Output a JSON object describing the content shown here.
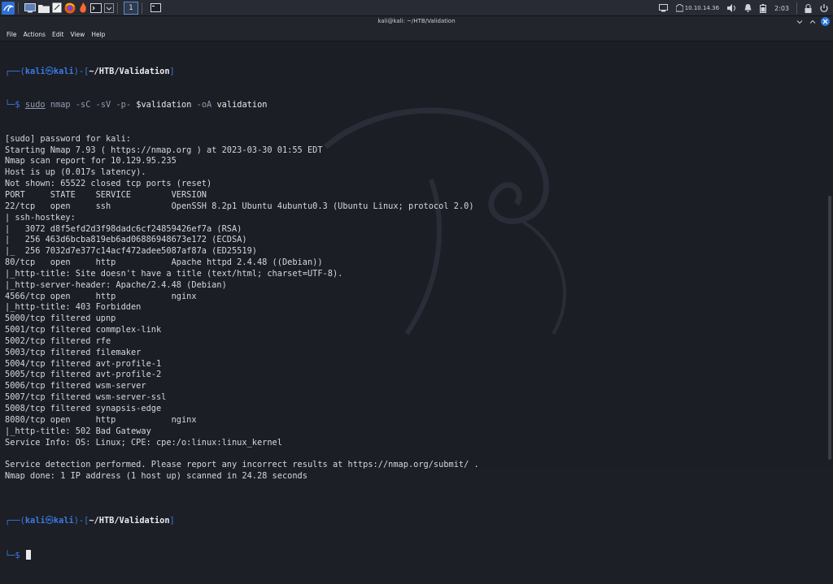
{
  "panel": {
    "workspace": "1",
    "ip": "10.10.14.36",
    "time": "2:03"
  },
  "window": {
    "title": "kali@kali: ~/HTB/Validation"
  },
  "menu": {
    "file": "File",
    "actions": "Actions",
    "edit": "Edit",
    "view": "View",
    "help": "Help"
  },
  "prompt1": {
    "corner": "┌──(",
    "user": "kali",
    "at": "㉿",
    "host": "kali",
    "mid": ")-[",
    "path": "~/HTB/Validation",
    "end": "]",
    "arrow": "└─$ ",
    "sudo": "sudo",
    "cmd": "nmap",
    "args": "-sC -sV -p-",
    "var": "$validation",
    "oa": "-oA",
    "out": "validation"
  },
  "output": [
    "[sudo] password for kali:",
    "Starting Nmap 7.93 ( https://nmap.org ) at 2023-03-30 01:55 EDT",
    "Nmap scan report for 10.129.95.235",
    "Host is up (0.017s latency).",
    "Not shown: 65522 closed tcp ports (reset)",
    "PORT     STATE    SERVICE        VERSION",
    "22/tcp   open     ssh            OpenSSH 8.2p1 Ubuntu 4ubuntu0.3 (Ubuntu Linux; protocol 2.0)",
    "| ssh-hostkey:",
    "|   3072 d8f5efd2d3f98dadc6cf24859426ef7a (RSA)",
    "|   256 463d6bcba819eb6ad06886948673e172 (ECDSA)",
    "|_  256 7032d7e377c14acf472adee5087af87a (ED25519)",
    "80/tcp   open     http           Apache httpd 2.4.48 ((Debian))",
    "|_http-title: Site doesn't have a title (text/html; charset=UTF-8).",
    "|_http-server-header: Apache/2.4.48 (Debian)",
    "4566/tcp open     http           nginx",
    "|_http-title: 403 Forbidden",
    "5000/tcp filtered upnp",
    "5001/tcp filtered commplex-link",
    "5002/tcp filtered rfe",
    "5003/tcp filtered filemaker",
    "5004/tcp filtered avt-profile-1",
    "5005/tcp filtered avt-profile-2",
    "5006/tcp filtered wsm-server",
    "5007/tcp filtered wsm-server-ssl",
    "5008/tcp filtered synapsis-edge",
    "8080/tcp open     http           nginx",
    "|_http-title: 502 Bad Gateway",
    "Service Info: OS: Linux; CPE: cpe:/o:linux:linux_kernel",
    "",
    "Service detection performed. Please report any incorrect results at https://nmap.org/submit/ .",
    "Nmap done: 1 IP address (1 host up) scanned in 24.28 seconds",
    ""
  ],
  "prompt2": {
    "corner": "┌──(",
    "user": "kali",
    "at": "㉿",
    "host": "kali",
    "mid": ")-[",
    "path": "~/HTB/Validation",
    "end": "]",
    "arrow": "└─$ "
  },
  "colors": {
    "prompt_blue": "#3b7ae5",
    "terminal_bg": "#1c1e25",
    "panel_bg": "#282b33",
    "close_button": "#2f7ae0"
  }
}
